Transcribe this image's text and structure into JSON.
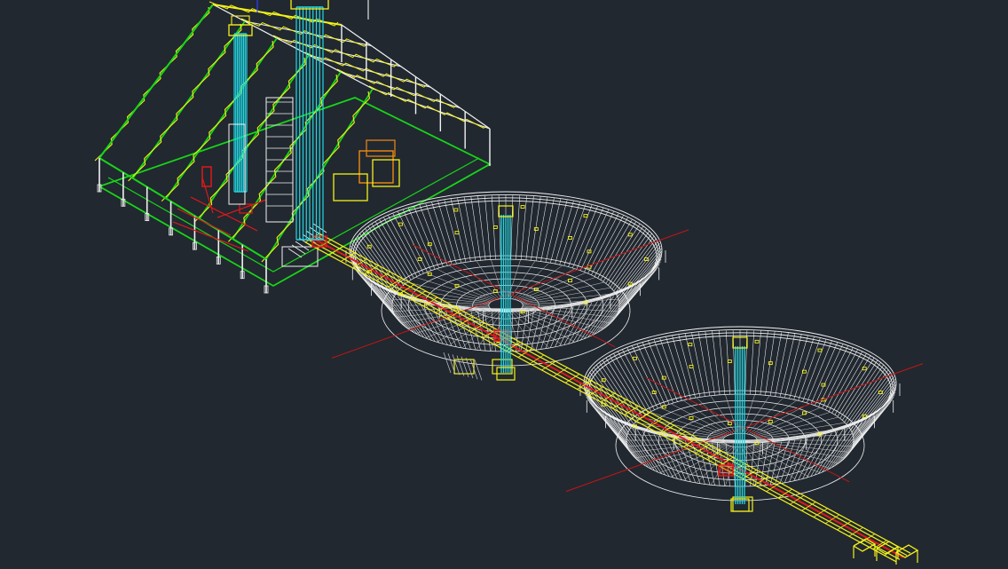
{
  "viewport": {
    "background": "#212830",
    "render_style": "isometric wireframe"
  },
  "colors": {
    "white": "#f2f2f2",
    "grey": "#c8c8c8",
    "yellow": "#f4f21a",
    "green": "#18d418",
    "cyan": "#22d8e4",
    "red": "#e01818",
    "dark_red": "#c21616",
    "orange": "#f08a12",
    "blue": "#3040ff"
  },
  "objects": [
    "industrial-shed",
    "tower-left",
    "tower-main",
    "conveyor-gallery",
    "thickener-tank-1",
    "thickener-tank-2"
  ]
}
